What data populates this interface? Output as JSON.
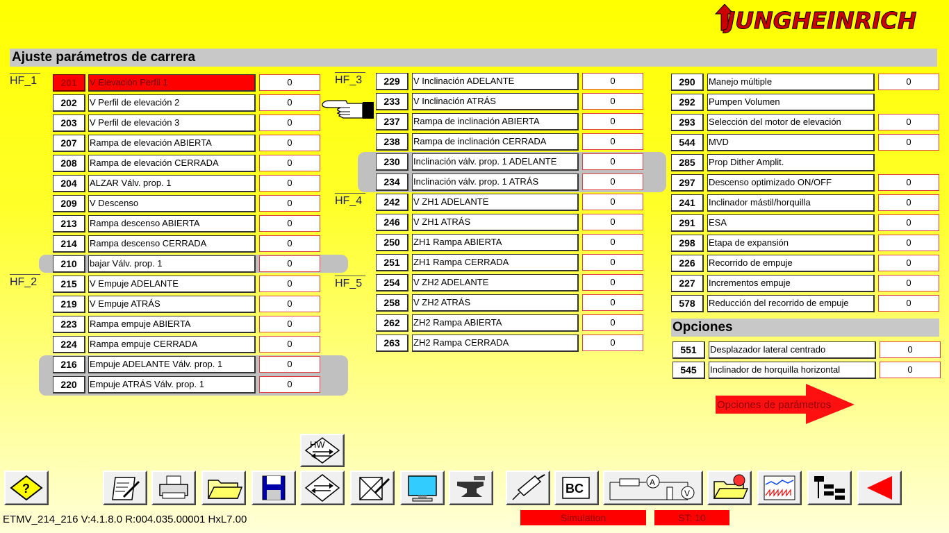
{
  "brand": "JUNGHEINRICH",
  "section_title": "Ajuste parámetros de carrera",
  "groups": {
    "hf1": "HF_1",
    "hf2": "HF_2",
    "hf3": "HF_3",
    "hf4": "HF_4",
    "hf5": "HF_5"
  },
  "col1": [
    {
      "num": "201",
      "label": "V  Elevación Perfil  1",
      "value": "0",
      "selected": true
    },
    {
      "num": "202",
      "label": "V  Perfil de elevación  2",
      "value": "0"
    },
    {
      "num": "203",
      "label": "V  Perfil de elevación  3",
      "value": "0"
    },
    {
      "num": "207",
      "label": "Rampa  de elevación ABIERTA",
      "value": "0"
    },
    {
      "num": "208",
      "label": "Rampa  de elevación CERRADA",
      "value": "0"
    },
    {
      "num": "204",
      "label": "ALZAR Válv. prop.  1",
      "value": "0"
    },
    {
      "num": "209",
      "label": "V  Descenso",
      "value": "0"
    },
    {
      "num": "213",
      "label": "Rampa  descenso ABIERTA",
      "value": "0"
    },
    {
      "num": "214",
      "label": "Rampa  descenso CERRADA",
      "value": "0"
    },
    {
      "num": "210",
      "label": "bajar Válv. prop.  1",
      "value": "0"
    },
    {
      "num": "215",
      "label": "V  Empuje ADELANTE",
      "value": "0"
    },
    {
      "num": "219",
      "label": "V  Empuje ATRÁS",
      "value": "0"
    },
    {
      "num": "223",
      "label": "Rampa  empuje ABIERTA",
      "value": "0"
    },
    {
      "num": "224",
      "label": "Rampa  empuje CERRADA",
      "value": "0"
    },
    {
      "num": "216",
      "label": "Empuje ADELANTE Válv. prop.  1",
      "value": "0"
    },
    {
      "num": "220",
      "label": "Empuje ATRÁS Válv. prop.  1",
      "value": "0"
    }
  ],
  "col2": [
    {
      "num": "229",
      "label": "V  Inclinación ADELANTE",
      "value": "0"
    },
    {
      "num": "233",
      "label": "V  Inclinación ATRÁS",
      "value": "0"
    },
    {
      "num": "237",
      "label": "Rampa de  inclinación ABIERTA",
      "value": "0"
    },
    {
      "num": "238",
      "label": "Rampa de  inclinación CERRADA",
      "value": "0"
    },
    {
      "num": "230",
      "label": "Inclinación  válv. prop.  1 ADELANTE",
      "value": "0"
    },
    {
      "num": "234",
      "label": "Inclinación  válv. prop.  1 ATRÁS",
      "value": "0"
    },
    {
      "num": "242",
      "label": "V   ZH1 ADELANTE",
      "value": "0"
    },
    {
      "num": "246",
      "label": "V  ZH1 ATRÁS",
      "value": "0"
    },
    {
      "num": "250",
      "label": "ZH1  Rampa ABIERTA",
      "value": "0"
    },
    {
      "num": "251",
      "label": "ZH1  Rampa CERRADA",
      "value": "0"
    },
    {
      "num": "254",
      "label": "V  ZH2 ADELANTE",
      "value": "0"
    },
    {
      "num": "258",
      "label": "V  ZH2 ATRÁS",
      "value": "0"
    },
    {
      "num": "262",
      "label": "ZH2  Rampa ABIERTA",
      "value": "0"
    },
    {
      "num": "263",
      "label": "ZH2  Rampa CERRADA",
      "value": "0"
    }
  ],
  "col3": [
    {
      "num": "290",
      "label": "Manejo múltiple",
      "value": "0"
    },
    {
      "num": "292",
      "label": " Pumpen  Volumen",
      "value": ""
    },
    {
      "num": "293",
      "label": "Selección del motor de elevación",
      "value": "0"
    },
    {
      "num": "544",
      "label": "MVD",
      "value": "0"
    },
    {
      "num": "285",
      "label": " Prop  Dither  Amplit.",
      "value": ""
    },
    {
      "num": "297",
      "label": "Descenso optimizado ON/OFF",
      "value": "0"
    },
    {
      "num": "241",
      "label": "Inclinador  mástil/horquilla",
      "value": "0"
    },
    {
      "num": "291",
      "label": "ESA",
      "value": "0"
    },
    {
      "num": "298",
      "label": "Etapa de expansión",
      "value": "0"
    },
    {
      "num": "226",
      "label": "Recorrido de empuje",
      "value": "0"
    },
    {
      "num": "227",
      "label": "Incrementos  empuje",
      "value": "0"
    },
    {
      "num": "578",
      "label": "Reducción del  recorrido de empuje",
      "value": "0"
    }
  ],
  "options_title": "Opciones",
  "options": [
    {
      "num": "551",
      "label": "Desplazador lateral centrado",
      "value": "0"
    },
    {
      "num": "545",
      "label": "Inclinador de horquilla horizontal",
      "value": "0"
    }
  ],
  "options_link": "Opciones de parámetros",
  "toolbar": {
    "hw_label": "HW",
    "bc_label": "BC",
    "icons": [
      "help-icon",
      "edit-icon",
      "print-icon",
      "folder-icon",
      "save-icon",
      "transfer-icon",
      "erase-icon",
      "monitor-icon",
      "anvil-icon",
      "syringe-icon",
      "bc-icon",
      "circuit-icon",
      "folder-target-icon",
      "signal-icon",
      "tree-icon",
      "back-icon"
    ]
  },
  "status": {
    "version": "ETMV_214_216 V:4.1.8.0 R:004.035.00001 HxL7.00",
    "simulation": "Simulation",
    "st": "ST: 10"
  },
  "colors": {
    "accent_red": "#ff0000",
    "background": "#ffff00"
  }
}
